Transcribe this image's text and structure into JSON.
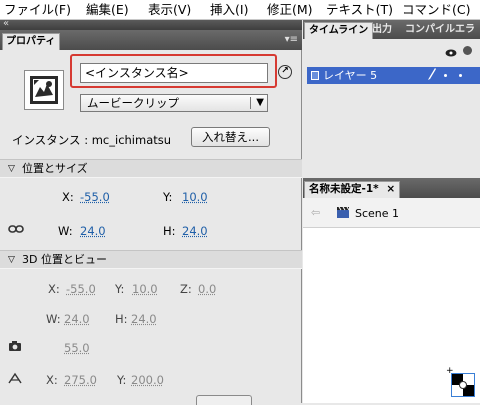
{
  "menu": {
    "items": [
      "ファイル(F)",
      "編集(E)",
      "表示(V)",
      "挿入(I)",
      "修正(M)",
      "テキスト(T)",
      "コマンド(C)"
    ]
  },
  "properties_panel": {
    "collapse_glyph": "«",
    "tab_label": "プロパティ",
    "menu_glyph": "▾≡",
    "instance_name_placeholder": "<インスタンス名>",
    "symbol_type": "ムービークリップ",
    "instance_label": "インスタンス : mc_ichimatsu",
    "swap_button": "入れ替え...",
    "sections": {
      "position_size": "位置とサイズ",
      "position_3d": "3D 位置とビュー"
    },
    "position": {
      "x_label": "X:",
      "x_value": "-55.0",
      "y_label": "Y:",
      "y_value": "10.0"
    },
    "size": {
      "w_label": "W:",
      "w_value": "24.0",
      "h_label": "H:",
      "h_value": "24.0"
    },
    "pos3d": {
      "x_label": "X:",
      "x_value": "-55.0",
      "y_label": "Y:",
      "y_value": "10.0",
      "z_label": "Z:",
      "z_value": "0.0"
    },
    "size3d": {
      "w_label": "W:",
      "w_value": "24.0",
      "h_label": "H:",
      "h_value": "24.0"
    },
    "perspective_value": "55.0",
    "vanishing": {
      "x_label": "X:",
      "x_value": "275.0",
      "y_label": "Y:",
      "y_value": "200.0"
    }
  },
  "timeline_panel": {
    "tabs": [
      "タイムライン",
      "出力",
      "コンパイルエラー"
    ],
    "layer_name": "レイヤー 5"
  },
  "document": {
    "tab_label": "名称未設定-1*",
    "close_glyph": "×",
    "scene_label": "Scene 1"
  },
  "colors": {
    "accent_blue": "#3c67c8",
    "highlight_red": "#d63a32",
    "value_blue": "#1f5fa8"
  }
}
